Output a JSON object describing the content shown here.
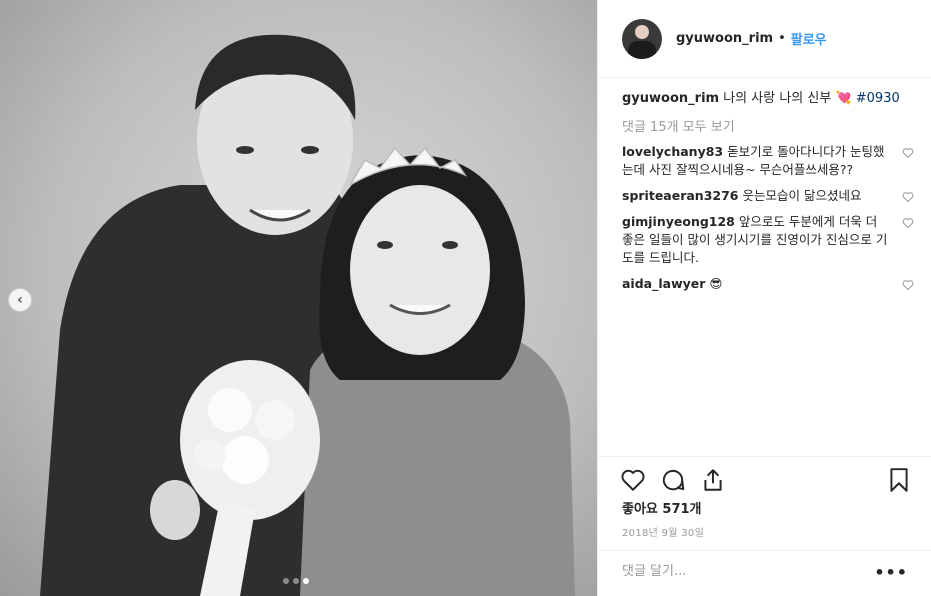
{
  "post": {
    "author": "gyuwoon_rim",
    "follow_sep": "•",
    "follow_label": "팔로우",
    "caption_user": "gyuwoon_rim",
    "caption_text": "나의 사랑 나의 신부",
    "caption_emoji": "💘",
    "caption_hashtag": "#0930",
    "view_all_comments": "댓글 15개 모두 보기",
    "comments": [
      {
        "user": "lovelychany83",
        "text": "돋보기로 돌아다니다가 눈팅했는데 사진 잘찍으시네용~ 무슨어플쓰세용??"
      },
      {
        "user": "spriteaeran3276",
        "text": "웃는모습이 닮으셨네요"
      },
      {
        "user": "gimjinyeong128",
        "text": "앞으로도 두분에게 더욱 더 좋은 일들이 많이 생기시기를 진영이가 진심으로 기도를 드립니다."
      },
      {
        "user": "aida_lawyer",
        "text": "😎"
      }
    ],
    "likes": "좋아요 571개",
    "date": "2018년 9월 30일",
    "comment_placeholder": "댓글 달기...",
    "more_label": "•••",
    "carousel_prev": "‹",
    "carousel_count": 3,
    "carousel_active": 3
  },
  "icons": {
    "heart": "heart-icon",
    "comment": "comment-icon",
    "share": "share-icon",
    "bookmark": "bookmark-icon"
  }
}
